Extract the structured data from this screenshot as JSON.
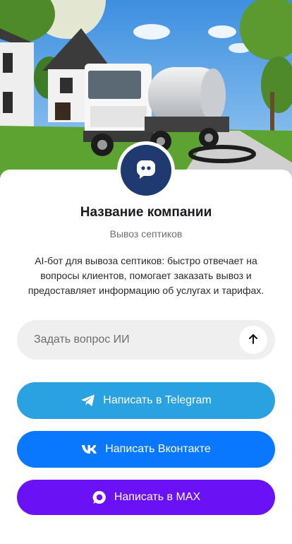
{
  "hero": {
    "image": "septic-truck-photo"
  },
  "company": {
    "avatar_icon": "chat-bot-icon",
    "name": "Название компании",
    "category": "Вывоз септиков",
    "description": "AI-бот для вывоза септиков: быстро отвечает на вопросы клиентов, помогает заказать вывоз и предоставляет информацию об услугах и тарифах."
  },
  "ask": {
    "placeholder": "Задать вопрос ИИ",
    "value": "",
    "send_icon": "arrow-up-icon"
  },
  "buttons": {
    "telegram": {
      "label": "Написать в Telegram",
      "icon": "telegram-icon",
      "color": "#2aa1e0"
    },
    "vk": {
      "label": "Написать Вконтакте",
      "icon": "vk-icon",
      "color": "#0a77ff"
    },
    "max": {
      "label": "Написать в MAX",
      "icon": "max-icon",
      "color": "#6a12f5"
    }
  }
}
